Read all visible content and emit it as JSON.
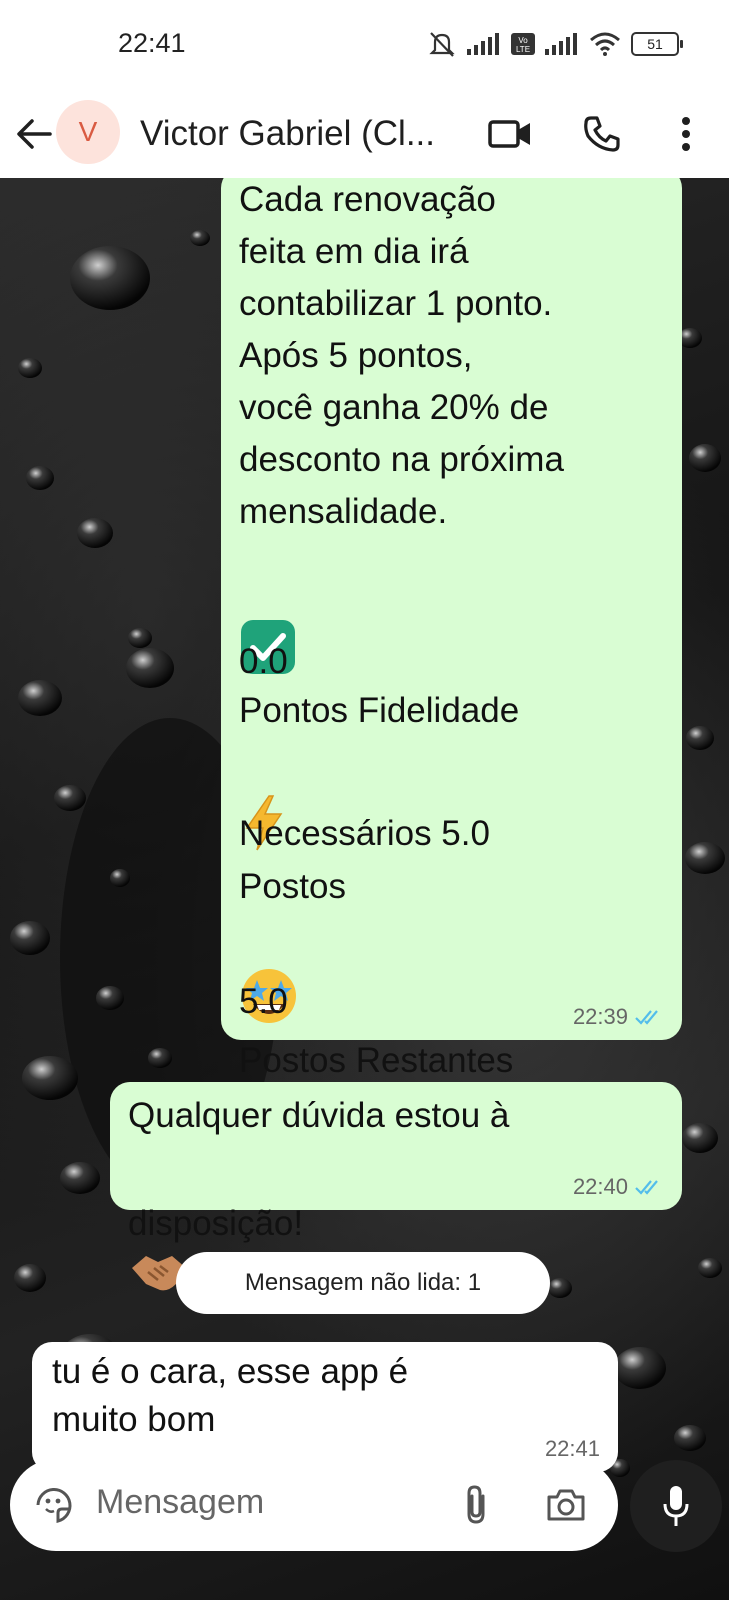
{
  "status": {
    "time": "22:41",
    "battery": "51"
  },
  "header": {
    "avatar_letter": "V",
    "contact_name": "Victor Gabriel (Cl..."
  },
  "messages": [
    {
      "text": "Cada renovação\nfeita em dia irá\ncontabilizar 1 ponto.\nApós 5 pontos,\nvocê ganha 20% de\ndesconto na próxima\nmensalidade.",
      "line_pontos_label": "Pontos Fidelidade",
      "line_pontos_value": "0.0",
      "line_necessarios_a": "Postos",
      "line_necessarios_b": "Necessários 5.0",
      "line_restantes_label": "Postos Restantes",
      "line_restantes_value": "5.0",
      "time": "22:39"
    },
    {
      "text_a": "Qualquer dúvida estou à",
      "text_b": "disposição!",
      "time": "22:40"
    },
    {
      "text": "tu é o cara, esse app é\nmuito bom",
      "time": "22:41"
    }
  ],
  "unread_label": "Mensagem não lida: 1",
  "input": {
    "placeholder": "Mensagem"
  },
  "icons": {
    "back": "arrow-left-icon",
    "video": "video-call-icon",
    "phone": "phone-icon",
    "menu": "more-vert-icon",
    "sticker": "sticker-icon",
    "attach": "paperclip-icon",
    "camera": "camera-icon",
    "mic": "microphone-icon",
    "read": "double-check-icon"
  },
  "colors": {
    "outgoing_bubble": "#d9fdd3",
    "incoming_bubble": "#ffffff",
    "read_tick": "#53bdeb",
    "avatar_bg": "#fde3dc",
    "avatar_text": "#d95b42"
  }
}
